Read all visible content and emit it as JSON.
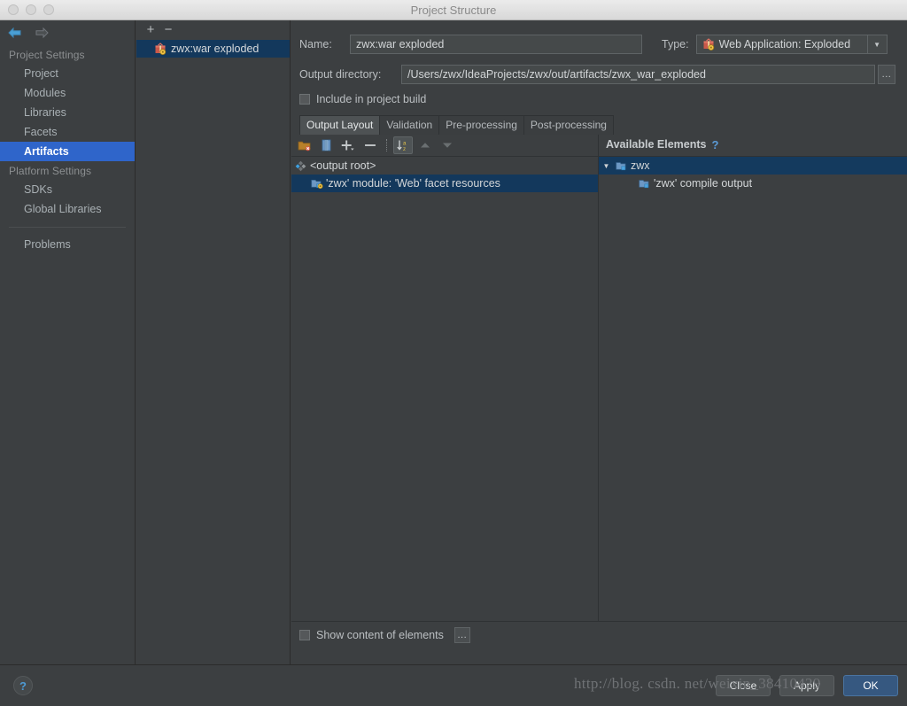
{
  "window": {
    "title": "Project Structure",
    "traffic_lights": [
      "close-dot",
      "minimize-dot",
      "zoom-dot"
    ]
  },
  "sidebar": {
    "back_icon": "back-arrow-icon",
    "forward_icon": "forward-arrow-icon",
    "sections": [
      {
        "label": "Project Settings",
        "items": [
          {
            "label": "Project",
            "selected": false
          },
          {
            "label": "Modules",
            "selected": false
          },
          {
            "label": "Libraries",
            "selected": false
          },
          {
            "label": "Facets",
            "selected": false
          },
          {
            "label": "Artifacts",
            "selected": true
          }
        ]
      },
      {
        "label": "Platform Settings",
        "items": [
          {
            "label": "SDKs",
            "selected": false
          },
          {
            "label": "Global Libraries",
            "selected": false
          }
        ]
      }
    ],
    "problems": "Problems"
  },
  "artifact_list": {
    "add_label": "+",
    "remove_label": "−",
    "items": [
      {
        "label": "zwx:war exploded",
        "icon": "artifact-gift-icon",
        "selected": true
      }
    ]
  },
  "details": {
    "name_label": "Name:",
    "name_value": "zwx:war exploded",
    "type_label": "Type:",
    "type_value": "Web Application: Exploded",
    "type_icon": "artifact-gift-icon",
    "output_dir_label": "Output directory:",
    "output_dir_value": "/Users/zwx/IdeaProjects/zwx/out/artifacts/zwx_war_exploded",
    "browse_label": "...",
    "include_in_build_label": "Include in project build",
    "include_in_build_checked": false,
    "tabs": [
      {
        "label": "Output Layout",
        "active": true
      },
      {
        "label": "Validation",
        "active": false
      },
      {
        "label": "Pre-processing",
        "active": false
      },
      {
        "label": "Post-processing",
        "active": false
      }
    ]
  },
  "layout_toolbar": {
    "buttons": [
      {
        "name": "add-directory-icon",
        "tip": "Create Directory"
      },
      {
        "name": "add-archive-icon",
        "tip": "Create Archive"
      },
      {
        "name": "add-copy-icon",
        "tip": "Add Copy of"
      },
      {
        "name": "remove-icon",
        "tip": "Remove"
      },
      {
        "name": "sort-az-icon",
        "tip": "Sort by Name",
        "active": true
      },
      {
        "name": "move-up-icon",
        "tip": "Move Up"
      },
      {
        "name": "move-down-icon",
        "tip": "Move Down"
      }
    ]
  },
  "output_tree": {
    "nodes": [
      {
        "label": "<output root>",
        "icon": "output-root-icon",
        "depth": 0,
        "selected": false
      },
      {
        "label": "'zwx' module: 'Web' facet resources",
        "icon": "facet-resources-icon",
        "depth": 1,
        "selected": true
      }
    ]
  },
  "available_elements": {
    "title": "Available Elements",
    "help_icon": "help-question-icon",
    "nodes": [
      {
        "label": "zwx",
        "icon": "module-folder-icon",
        "depth": 0,
        "expanded": true,
        "selected": true
      },
      {
        "label": "'zwx' compile output",
        "icon": "module-folder-icon",
        "depth": 1,
        "expanded": null,
        "selected": false
      }
    ]
  },
  "bottom_options": {
    "show_content_label": "Show content of elements",
    "show_content_checked": false,
    "settings_label": "..."
  },
  "footer": {
    "help_label": "?",
    "buttons": [
      {
        "label": "Close",
        "primary": false
      },
      {
        "label": "Apply",
        "primary": false
      },
      {
        "label": "OK",
        "primary": true
      }
    ]
  },
  "watermark": {
    "text": "http://blog. csdn. net/weixin_38410429"
  },
  "colors": {
    "accent_selection": "#2f65ca",
    "tree_selection": "#13385c",
    "panel_bg": "#3c3f41",
    "primary_button": "#365880",
    "link_blue": "#5b9ad6"
  }
}
